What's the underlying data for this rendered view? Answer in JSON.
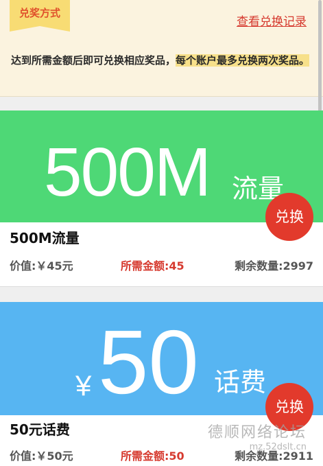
{
  "info": {
    "ribbon_label": "兑奖方式",
    "record_link": "查看兑换记录",
    "notice_text": "达到所需金额后即可兑换相应奖品，",
    "notice_highlight": "每个账户最多兑换两次奖品。"
  },
  "cards": [
    {
      "banner_main": "500M",
      "banner_unit": "流量",
      "banner_color": "#4ed876",
      "button_label": "兑换",
      "name": "500M流量",
      "value": "价值:￥45元",
      "cost": "所需金额:45",
      "stock": "剩余数量:2997"
    },
    {
      "banner_prefix": "¥",
      "banner_main": "50",
      "banner_unit": "话费",
      "banner_color": "#57b5f2",
      "button_label": "兑换",
      "name": "50元话费",
      "value": "价值:￥50元",
      "cost": "所需金额:50",
      "stock": "剩余数量:2911"
    }
  ],
  "watermark": {
    "main": "德顺网络论坛",
    "sub": "mz.52dslt.cn"
  },
  "colors": {
    "accent_red": "#e23a2c",
    "ribbon_yellow": "#f8dc74",
    "panel_bg": "#fbf3df"
  }
}
